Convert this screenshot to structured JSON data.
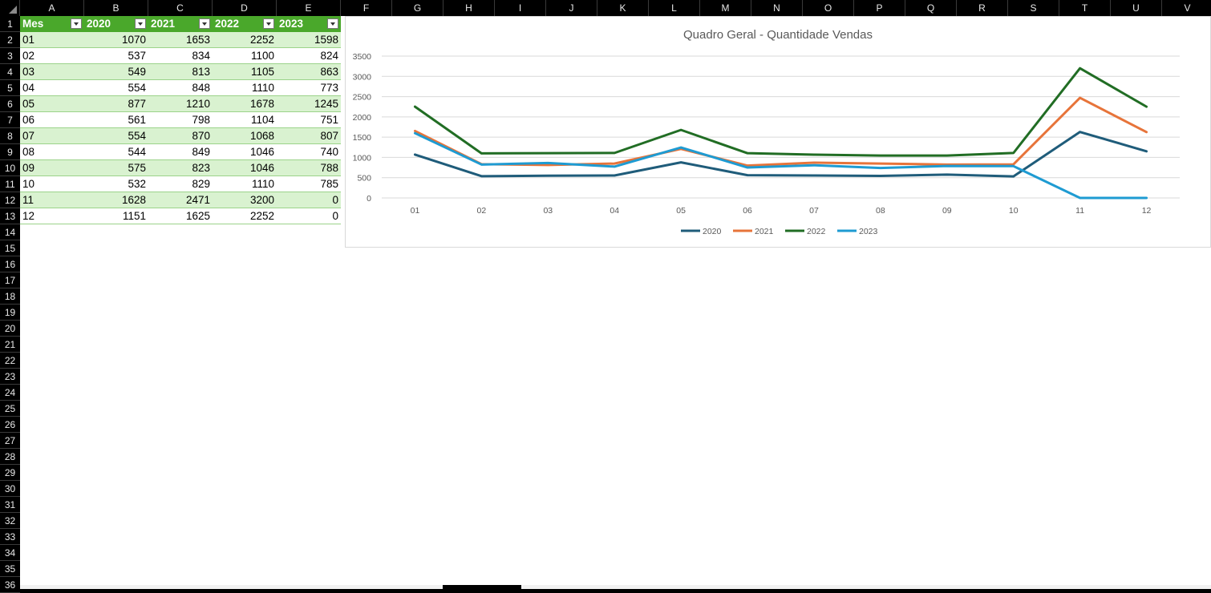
{
  "columns": [
    "A",
    "B",
    "C",
    "D",
    "E",
    "F",
    "G",
    "H",
    "I",
    "J",
    "K",
    "L",
    "M",
    "N",
    "O",
    "P",
    "Q",
    "R",
    "S",
    "T",
    "U",
    "V"
  ],
  "rows": [
    "1",
    "2",
    "3",
    "4",
    "5",
    "6",
    "7",
    "8",
    "9",
    "10",
    "11",
    "12",
    "13",
    "14",
    "15",
    "16",
    "17",
    "18",
    "19",
    "20",
    "21",
    "22",
    "23",
    "24",
    "25",
    "26",
    "27",
    "28",
    "29",
    "30",
    "31",
    "32",
    "33",
    "34",
    "35",
    "36"
  ],
  "table": {
    "headers": [
      "Mes",
      "2020",
      "2021",
      "2022",
      "2023"
    ],
    "rows": [
      [
        "01",
        "1070",
        "1653",
        "2252",
        "1598"
      ],
      [
        "02",
        "537",
        "834",
        "1100",
        "824"
      ],
      [
        "03",
        "549",
        "813",
        "1105",
        "863"
      ],
      [
        "04",
        "554",
        "848",
        "1110",
        "773"
      ],
      [
        "05",
        "877",
        "1210",
        "1678",
        "1245"
      ],
      [
        "06",
        "561",
        "798",
        "1104",
        "751"
      ],
      [
        "07",
        "554",
        "870",
        "1068",
        "807"
      ],
      [
        "08",
        "544",
        "849",
        "1046",
        "740"
      ],
      [
        "09",
        "575",
        "823",
        "1046",
        "788"
      ],
      [
        "10",
        "532",
        "829",
        "1110",
        "785"
      ],
      [
        "11",
        "1628",
        "2471",
        "3200",
        "0"
      ],
      [
        "12",
        "1151",
        "1625",
        "2252",
        "0"
      ]
    ]
  },
  "chart_data": {
    "type": "line",
    "title": "Quadro Geral - Quantidade Vendas",
    "xlabel": "",
    "ylabel": "",
    "categories": [
      "01",
      "02",
      "03",
      "04",
      "05",
      "06",
      "07",
      "08",
      "09",
      "10",
      "11",
      "12"
    ],
    "yticks": [
      "0",
      "500",
      "1000",
      "1500",
      "2000",
      "2500",
      "3000",
      "3500"
    ],
    "ylim": [
      0,
      3500
    ],
    "grid": true,
    "legend": "bottom",
    "series": [
      {
        "name": "2020",
        "color": "#1f5c7a",
        "values": [
          1070,
          537,
          549,
          554,
          877,
          561,
          554,
          544,
          575,
          532,
          1628,
          1151
        ]
      },
      {
        "name": "2021",
        "color": "#e7743a",
        "values": [
          1653,
          834,
          813,
          848,
          1210,
          798,
          870,
          849,
          823,
          829,
          2471,
          1625
        ]
      },
      {
        "name": "2022",
        "color": "#216d24",
        "values": [
          2252,
          1100,
          1105,
          1110,
          1678,
          1104,
          1068,
          1046,
          1046,
          1110,
          3200,
          2252
        ]
      },
      {
        "name": "2023",
        "color": "#1e9bd2",
        "values": [
          1598,
          824,
          863,
          773,
          1245,
          751,
          807,
          740,
          788,
          785,
          0,
          0
        ]
      }
    ]
  }
}
